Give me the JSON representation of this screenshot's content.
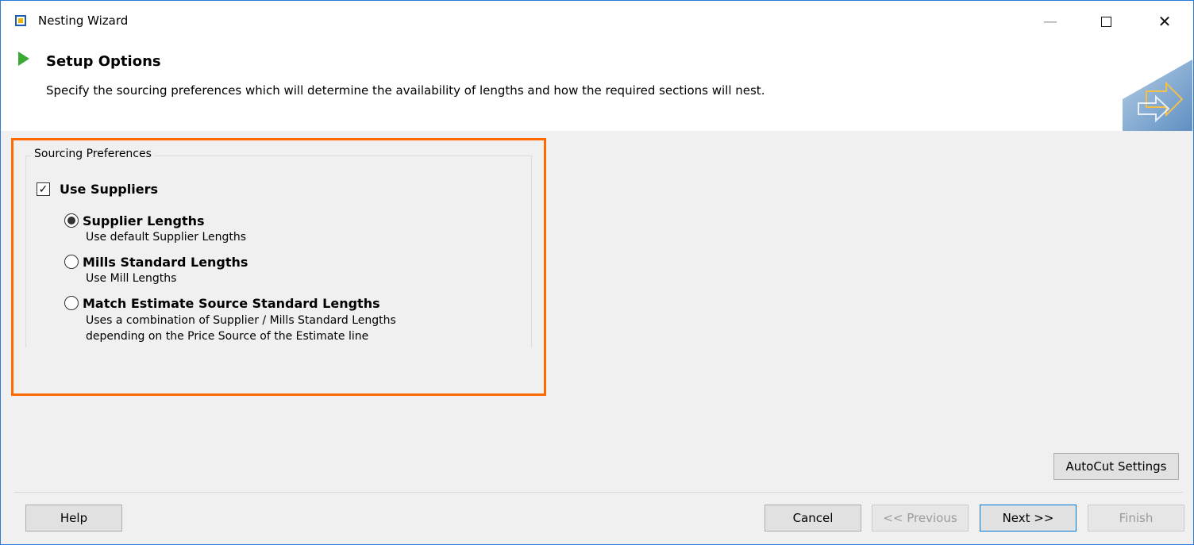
{
  "window": {
    "title": "Nesting Wizard",
    "icons": {
      "app": "wizard-app-icon",
      "minimize": "minimize-icon",
      "maximize": "maximize-icon",
      "close": "close-icon"
    }
  },
  "header": {
    "title": "Setup Options",
    "description": "Specify the sourcing preferences which will determine the availability of lengths and how the required sections will nest.",
    "icon": "green-play-icon"
  },
  "sourcing": {
    "group_label": "Sourcing Preferences",
    "use_suppliers": {
      "label": "Use Suppliers",
      "checked": true
    },
    "options": [
      {
        "label": "Supplier Lengths",
        "description": "Use default Supplier Lengths",
        "selected": true
      },
      {
        "label": "Mills Standard Lengths",
        "description": "Use Mill Lengths",
        "selected": false
      },
      {
        "label": "Match Estimate Source Standard Lengths",
        "description_line1": "Uses a combination of Supplier / Mills Standard Lengths",
        "description_line2": "depending on the Price Source of the Estimate line",
        "selected": false
      }
    ],
    "highlight_color": "#ff6a00"
  },
  "buttons": {
    "autocut": "AutoCut Settings",
    "help": "Help",
    "cancel": "Cancel",
    "previous": "<< Previous",
    "next": "Next >>",
    "finish": "Finish"
  },
  "colors": {
    "accent": "#3aaa35",
    "window_border": "#2b7bd8"
  }
}
